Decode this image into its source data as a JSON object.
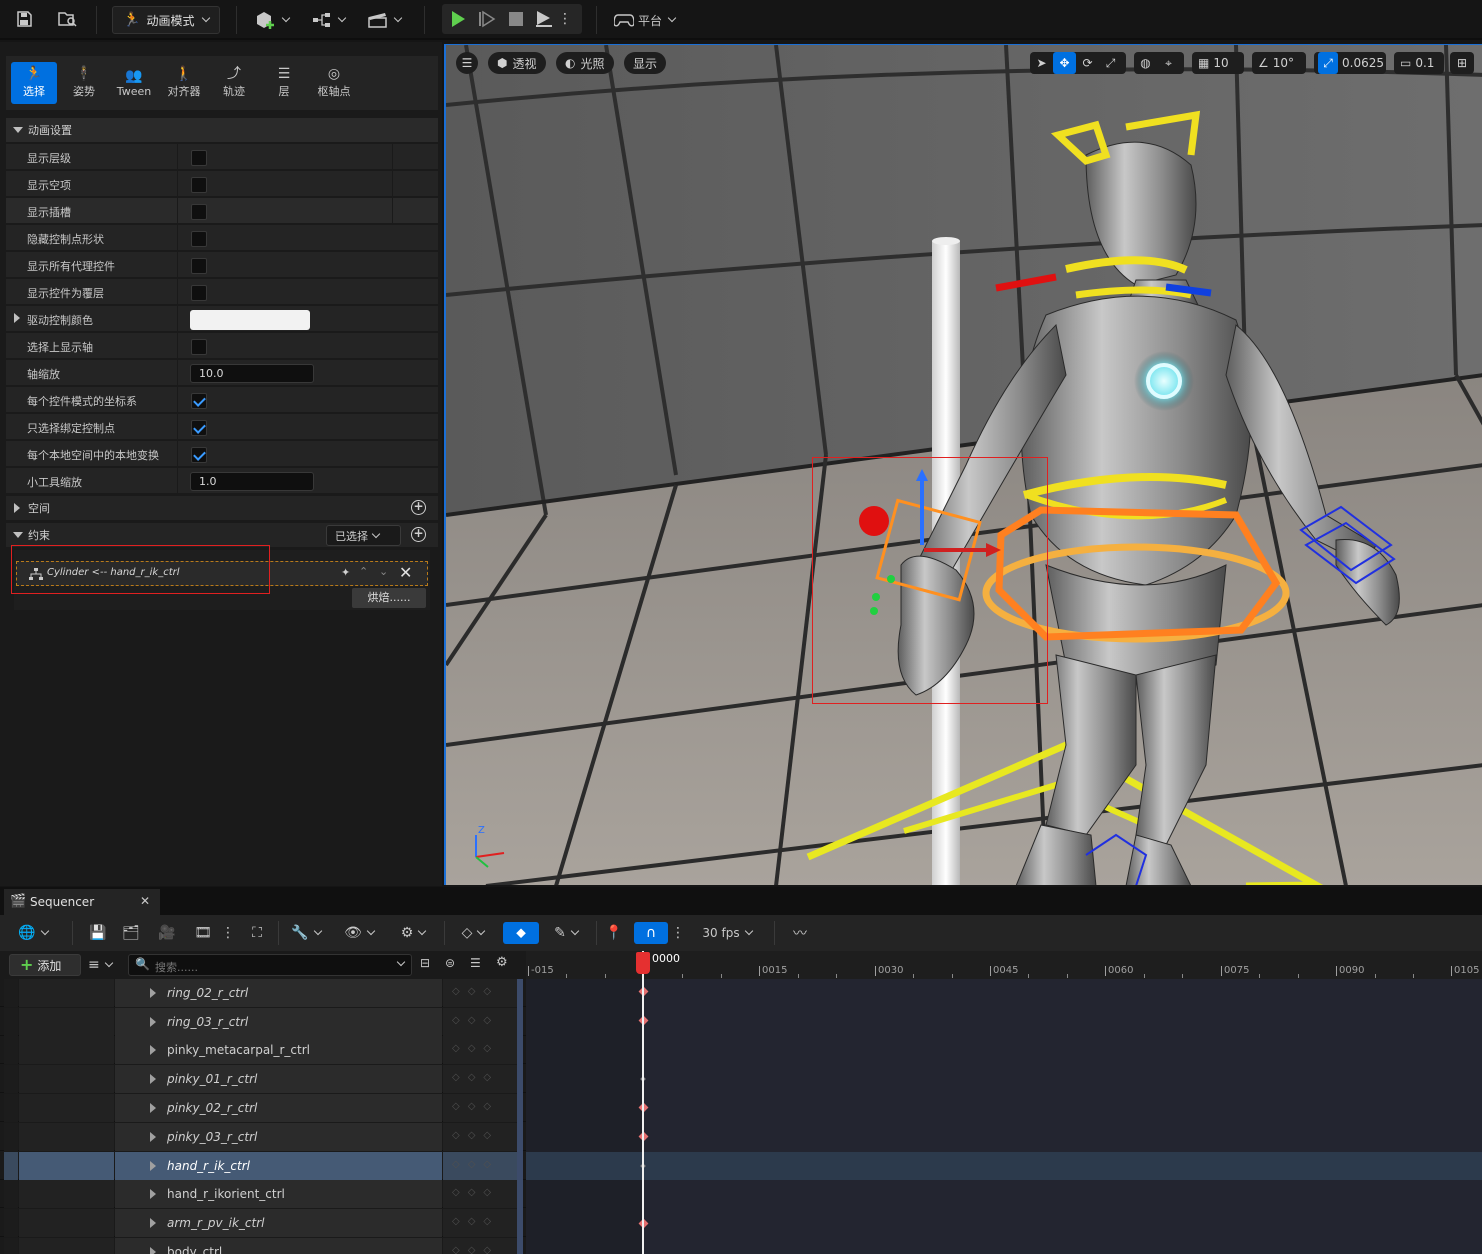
{
  "top_toolbar": {
    "mode_label": "动画模式",
    "platform_label": "平台",
    "icons": [
      "save-icon",
      "browse-icon",
      "add-actor-icon",
      "blueprint-icon",
      "cinematics-icon",
      "play-icon",
      "play-frame-icon",
      "stop-icon",
      "eject-icon",
      "more-icon",
      "platform-icon"
    ]
  },
  "mode_tabs": [
    {
      "label": "选择",
      "icon": "select-icon",
      "active": true
    },
    {
      "label": "姿势",
      "icon": "pose-icon"
    },
    {
      "label": "Tween",
      "icon": "tween-icon"
    },
    {
      "label": "对齐器",
      "icon": "aligner-icon"
    },
    {
      "label": "轨迹",
      "icon": "trail-icon"
    },
    {
      "label": "层",
      "icon": "layers-icon"
    },
    {
      "label": "枢轴点",
      "icon": "pivot-icon"
    }
  ],
  "details": {
    "anim_settings_title": "动画设置",
    "props": [
      {
        "label": "显示层级",
        "type": "check",
        "value": false
      },
      {
        "label": "显示空项",
        "type": "check",
        "value": false
      },
      {
        "label": "显示插槽",
        "type": "check",
        "value": false
      },
      {
        "label": "隐藏控制点形状",
        "type": "check",
        "value": false
      },
      {
        "label": "显示所有代理控件",
        "type": "check",
        "value": false
      },
      {
        "label": "显示控件为覆层",
        "type": "check",
        "value": false
      },
      {
        "label": "驱动控制颜色",
        "type": "color",
        "value": "#f2f2f2"
      },
      {
        "label": "选择上显示轴",
        "type": "check",
        "value": false
      },
      {
        "label": "轴缩放",
        "type": "number",
        "value": "10.0"
      },
      {
        "label": "每个控件模式的坐标系",
        "type": "check",
        "value": true
      },
      {
        "label": "只选择绑定控制点",
        "type": "check",
        "value": true
      },
      {
        "label": "每个本地空间中的本地变换",
        "type": "check",
        "value": true
      },
      {
        "label": "小工具缩放",
        "type": "number",
        "value": "1.0"
      }
    ],
    "space_title": "空间",
    "constraints_title": "约束",
    "selected_dropdown": "已选择",
    "constraint_item": "Cylinder <-- hand_r_ik_ctrl",
    "bake_button": "烘焙......"
  },
  "viewport": {
    "perspective_label": "透视",
    "lighting_label": "光照",
    "show_label": "显示",
    "grid_snap": "10",
    "rotation_snap": "10°",
    "scale_snap": "0.0625",
    "camera_speed": "0.1",
    "axis_z": "Z",
    "accent": "#0070e0"
  },
  "sequencer": {
    "tab_title": "Sequencer",
    "fps_label": "30 fps",
    "add_button": "添加",
    "search_placeholder": "搜索......",
    "playhead_label": "0000",
    "ruler_labels": [
      "-015",
      "0015",
      "0030",
      "0045",
      "0060",
      "0075",
      "0090",
      "0105"
    ],
    "tracks": [
      {
        "name": "ring_02_r_ctrl",
        "italic": true,
        "key": true
      },
      {
        "name": "ring_03_r_ctrl",
        "italic": true,
        "key": true
      },
      {
        "name": "pinky_metacarpal_r_ctrl",
        "italic": false,
        "key": false
      },
      {
        "name": "pinky_01_r_ctrl",
        "italic": true,
        "key": false
      },
      {
        "name": "pinky_02_r_ctrl",
        "italic": true,
        "key": true
      },
      {
        "name": "pinky_03_r_ctrl",
        "italic": true,
        "key": true
      },
      {
        "name": "hand_r_ik_ctrl",
        "italic": true,
        "key": false,
        "selected": true
      },
      {
        "name": "hand_r_ikorient_ctrl",
        "italic": false,
        "key": false
      },
      {
        "name": "arm_r_pv_ik_ctrl",
        "italic": true,
        "key": true
      },
      {
        "name": "body_ctrl",
        "italic": false,
        "key": false
      }
    ]
  }
}
